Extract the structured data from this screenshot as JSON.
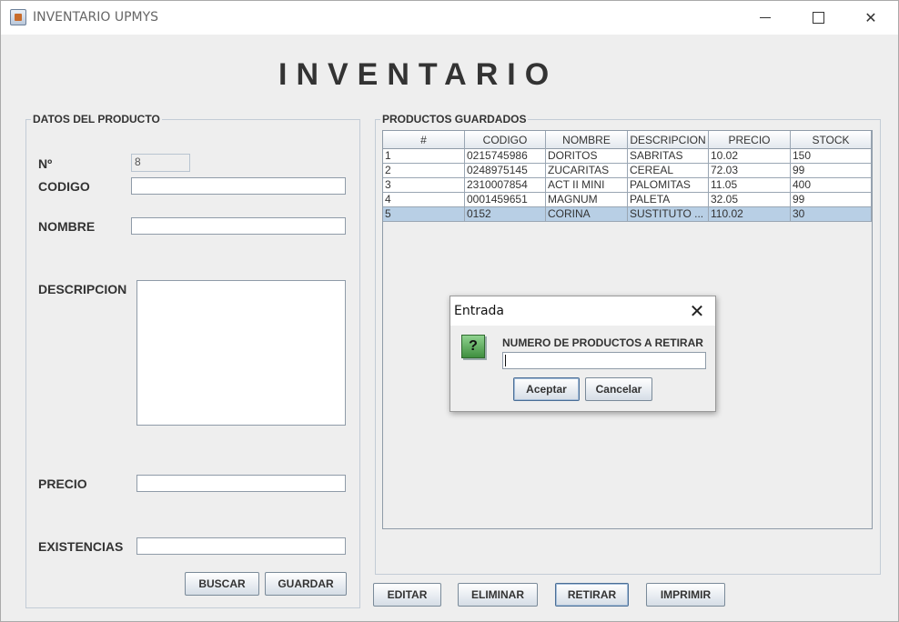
{
  "window": {
    "title": "INVENTARIO UPMYS",
    "minimize_label": "",
    "maximize_label": "",
    "close_label": "✕"
  },
  "header": {
    "title": "INVENTARIO"
  },
  "left_panel": {
    "group_label": "DATOS DEL PRODUCTO",
    "number_label": "Nº",
    "number_value": "8",
    "codigo_label": "CODIGO",
    "codigo_value": "",
    "nombre_label": "NOMBRE",
    "nombre_value": "",
    "descripcion_label": "DESCRIPCION",
    "precio_label": "PRECIO",
    "precio_value": "",
    "existencias_label": "EXISTENCIAS",
    "existencias_value": "",
    "buscar_label": "BUSCAR",
    "guardar_label": "GUARDAR"
  },
  "right_panel": {
    "group_label": "PRODUCTOS GUARDADOS",
    "columns": [
      "#",
      "CODIGO",
      "NOMBRE",
      "DESCRIPCION",
      "PRECIO",
      "STOCK"
    ],
    "rows": [
      [
        "1",
        "0215745986",
        "DORITOS",
        "SABRITAS",
        "10.02",
        "150"
      ],
      [
        "2",
        "0248975145",
        "ZUCARITAS",
        "CEREAL",
        "72.03",
        "99"
      ],
      [
        "3",
        "2310007854",
        "ACT II MINI",
        "PALOMITAS",
        "11.05",
        "400"
      ],
      [
        "4",
        "0001459651",
        "MAGNUM",
        "PALETA",
        "32.05",
        "99"
      ],
      [
        "5",
        "0152",
        "CORINA",
        "SUSTITUTO ...",
        "110.02",
        "30"
      ]
    ],
    "selected_row": 4
  },
  "actions": {
    "editar_label": "EDITAR",
    "eliminar_label": "ELIMINAR",
    "retirar_label": "RETIRAR",
    "imprimir_label": "IMPRIMIR"
  },
  "dialog": {
    "title": "Entrada",
    "close_label": "✕",
    "icon_glyph": "?",
    "message": "NUMERO DE PRODUCTOS A RETIRAR",
    "input_value": "",
    "accept_label": "Aceptar",
    "cancel_label": "Cancelar"
  }
}
